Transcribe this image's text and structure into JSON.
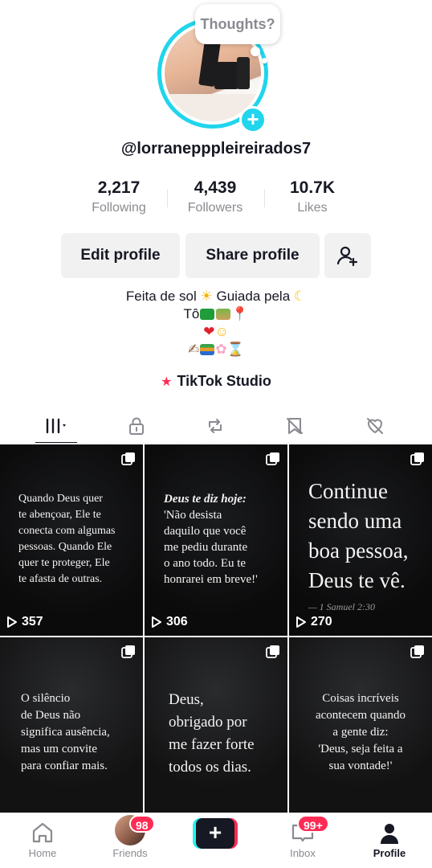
{
  "profile": {
    "thought_bubble": "Thoughts?",
    "username": "@lorranepppleireirados7",
    "stats": {
      "following": {
        "value": "2,217",
        "label": "Following"
      },
      "followers": {
        "value": "4,439",
        "label": "Followers"
      },
      "likes": {
        "value": "10.7K",
        "label": "Likes"
      }
    },
    "buttons": {
      "edit": "Edit profile",
      "share": "Share profile"
    },
    "bio": {
      "line1_text": "Feita de sol",
      "line1_text2": "Guiada pela",
      "line2_text": "Tô"
    },
    "studio_label": "TikTok Studio"
  },
  "tabs": [
    {
      "name": "videos",
      "icon": "grid-icon",
      "active": true
    },
    {
      "name": "private",
      "icon": "lock-icon"
    },
    {
      "name": "reposts",
      "icon": "repost-icon"
    },
    {
      "name": "saved",
      "icon": "bookmark-hidden-icon"
    },
    {
      "name": "liked",
      "icon": "heart-hidden-icon"
    }
  ],
  "posts": [
    {
      "views": "357",
      "lines": [
        "Quando Deus quer",
        "te abençoar, Ele te",
        "conecta com algumas",
        "pessoas. Quando Ele",
        "quer te proteger, Ele",
        "te afasta de outras."
      ]
    },
    {
      "views": "306",
      "heading": "Deus te diz hoje:",
      "lines": [
        "'Não desista",
        "daquilo que você",
        "me pediu durante",
        "o ano todo. Eu te",
        "honrarei em breve!'"
      ]
    },
    {
      "views": "270",
      "lines": [
        "Continue",
        "sendo uma",
        "boa pessoa,",
        "Deus te vê."
      ],
      "reference": "— 1 Samuel 2:30"
    },
    {
      "lines": [
        "O silêncio",
        "de Deus não",
        "significa ausência,",
        "mas um convite",
        "para confiar mais."
      ]
    },
    {
      "lines": [
        "Deus,",
        "obrigado por",
        "me fazer forte",
        "todos os dias."
      ]
    },
    {
      "lines": [
        "Coisas incríveis",
        "acontecem quando",
        "a gente diz:",
        "'Deus, seja feita a",
        "sua vontade!'"
      ]
    }
  ],
  "nav": {
    "home": "Home",
    "friends": "Friends",
    "friends_badge": "98",
    "inbox": "Inbox",
    "inbox_badge": "99+",
    "profile": "Profile",
    "post_symbol": "+"
  },
  "colors": {
    "accent_cyan": "#20d5ec",
    "accent_red": "#fe2c55",
    "text": "#161823",
    "muted": "#8a8b91"
  }
}
